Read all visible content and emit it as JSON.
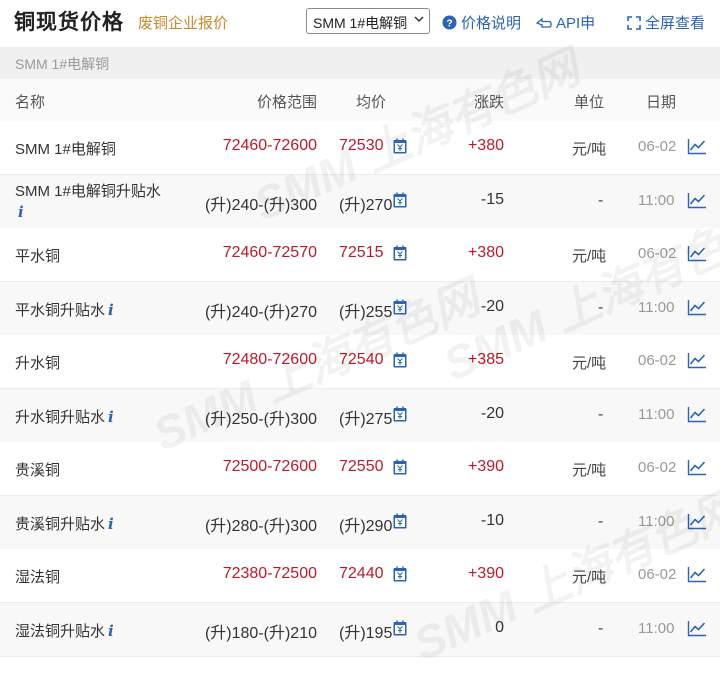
{
  "header": {
    "title": "铜现货价格",
    "scrap_link": "废铜企业报价",
    "select_value": "SMM 1#电解铜",
    "price_note": "价格说明",
    "api": "API申",
    "fullscreen": "全屏查看"
  },
  "section": {
    "label": "SMM 1#电解铜"
  },
  "table": {
    "headers": [
      "名称",
      "价格范围",
      "均价",
      "涨跌",
      "单位",
      "日期"
    ],
    "rows": [
      {
        "name": "SMM 1#电解铜",
        "info": false,
        "range": "72460-72600",
        "avg": "72530",
        "change": "+380",
        "unit": "元/吨",
        "date": "06-02",
        "red": true
      },
      {
        "name": "SMM 1#电解铜升贴水",
        "info": true,
        "range": "(升)240-(升)300",
        "avg": "(升)270",
        "change": "-15",
        "unit": "-",
        "date": "11:00",
        "red": false
      },
      {
        "name": "平水铜",
        "info": false,
        "range": "72460-72570",
        "avg": "72515",
        "change": "+380",
        "unit": "元/吨",
        "date": "06-02",
        "red": true
      },
      {
        "name": "平水铜升贴水",
        "info": true,
        "range": "(升)240-(升)270",
        "avg": "(升)255",
        "change": "-20",
        "unit": "-",
        "date": "11:00",
        "red": false
      },
      {
        "name": "升水铜",
        "info": false,
        "range": "72480-72600",
        "avg": "72540",
        "change": "+385",
        "unit": "元/吨",
        "date": "06-02",
        "red": true
      },
      {
        "name": "升水铜升贴水",
        "info": true,
        "range": "(升)250-(升)300",
        "avg": "(升)275",
        "change": "-20",
        "unit": "-",
        "date": "11:00",
        "red": false
      },
      {
        "name": "贵溪铜",
        "info": false,
        "range": "72500-72600",
        "avg": "72550",
        "change": "+390",
        "unit": "元/吨",
        "date": "06-02",
        "red": true
      },
      {
        "name": "贵溪铜升贴水",
        "info": true,
        "range": "(升)280-(升)300",
        "avg": "(升)290",
        "change": "-10",
        "unit": "-",
        "date": "11:00",
        "red": false
      },
      {
        "name": "湿法铜",
        "info": false,
        "range": "72380-72500",
        "avg": "72440",
        "change": "+390",
        "unit": "元/吨",
        "date": "06-02",
        "red": true
      },
      {
        "name": "湿法铜升贴水",
        "info": true,
        "range": "(升)180-(升)210",
        "avg": "(升)195",
        "change": "0",
        "unit": "-",
        "date": "11:00",
        "red": false
      }
    ]
  },
  "watermark": "SMM 上海有色网",
  "colors": {
    "accent_red": "#c0182a",
    "link_blue": "#2b63b5",
    "scrap_link": "#c98a2a"
  }
}
